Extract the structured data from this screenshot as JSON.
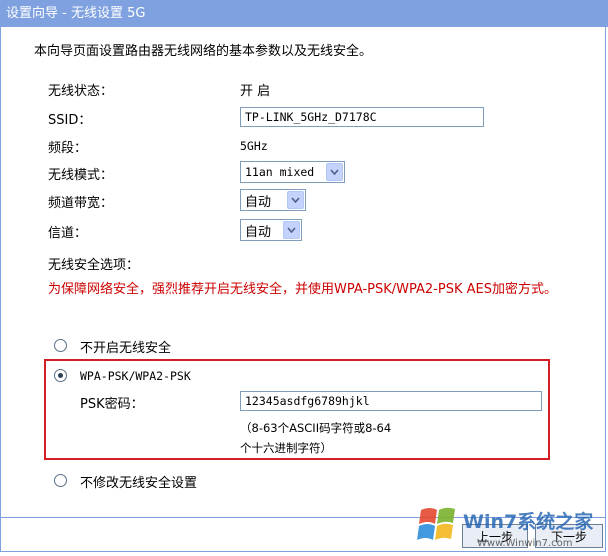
{
  "header": {
    "title": "设置向导 - 无线设置 5G"
  },
  "intro": "本向导页面设置路由器无线网络的基本参数以及无线安全。",
  "fields": {
    "wireless_status": {
      "label": "无线状态：",
      "value": "开 启"
    },
    "ssid": {
      "label": "SSID：",
      "value": "TP-LINK_5GHz_D7178C"
    },
    "band": {
      "label": "频段：",
      "value": "5GHz"
    },
    "mode": {
      "label": "无线模式：",
      "value": "11an mixed"
    },
    "bandwidth": {
      "label": "频道带宽：",
      "value": "自动"
    },
    "channel": {
      "label": "信道：",
      "value": "自动"
    }
  },
  "security": {
    "section_label": "无线安全选项：",
    "warning": "为保障网络安全，强烈推荐开启无线安全，并使用WPA-PSK/WPA2-PSK AES加密方式。",
    "options": [
      {
        "label": "不开启无线安全",
        "checked": false
      },
      {
        "label": "WPA-PSK/WPA2-PSK",
        "checked": true
      },
      {
        "label": "不修改无线安全设置",
        "checked": false
      }
    ],
    "psk_label": "PSK密码：",
    "psk_value": "12345asdfg6789hjkl",
    "psk_hint_line1": "（8-63个ASCII码字符或8-64",
    "psk_hint_line2": "个十六进制字符）"
  },
  "buttons": {
    "prev": "上一步",
    "next": "下一步"
  },
  "watermark": {
    "text_main": "Win7系统之家",
    "text_url": "Www.Winwin7.com"
  },
  "colors": {
    "title_bar": "#7fa1df",
    "warning_text": "#cc0000",
    "highlight_box": "#d31e25"
  }
}
